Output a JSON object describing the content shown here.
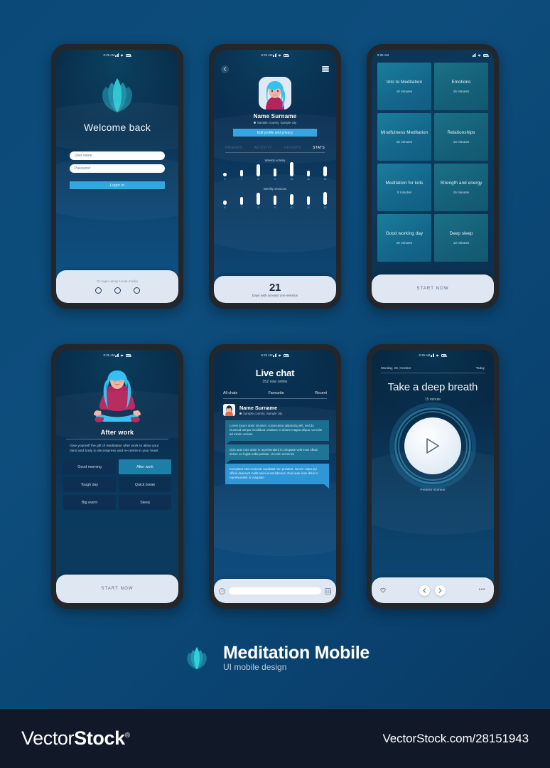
{
  "page": {
    "background_color": "#0b4a78"
  },
  "status_bar": {
    "time": "6:25 AM",
    "icons": [
      "signal-icon",
      "wifi-icon",
      "battery-icon"
    ]
  },
  "screens": {
    "login": {
      "name": "login-screen",
      "logo": "lotus-logo",
      "heading": "Welcome back",
      "username_placeholder": "User name",
      "password_placeholder": "Password",
      "login_button": "Login in",
      "social_label": "Or login using social media",
      "social_count": 3
    },
    "profile": {
      "name": "profile-stats-screen",
      "back_icon": "chevron-left-icon",
      "menu_icon": "hamburger-menu-icon",
      "user_name": "Name Surname",
      "user_location": "Sample country, Sample city",
      "edit_button": "Edit profile and privacy",
      "tabs": [
        {
          "label": "FRIENDS",
          "active": false
        },
        {
          "label": "ACTIVITY",
          "active": false
        },
        {
          "label": "GROUPS",
          "active": false
        },
        {
          "label": "STATS",
          "active": true
        }
      ],
      "chart_data": [
        {
          "type": "bar",
          "title": "Weekly activity",
          "categories": [
            "6",
            "7",
            "8",
            "9",
            "10",
            "11",
            "12"
          ],
          "values": [
            5,
            9,
            17,
            11,
            20,
            8,
            14
          ],
          "ylim": [
            0,
            22
          ],
          "xlabel": "",
          "ylabel": "",
          "grid": false,
          "legend": "none"
        },
        {
          "type": "bar",
          "title": "Weekly sessions",
          "categories": [
            "6",
            "7",
            "8",
            "9",
            "10",
            "11",
            "12"
          ],
          "values": [
            6,
            11,
            17,
            13,
            15,
            12,
            18
          ],
          "ylim": [
            0,
            22
          ],
          "xlabel": "",
          "ylabel": "",
          "grid": false,
          "legend": "none"
        }
      ],
      "streak_number": "21",
      "streak_label": "Days with at least one session"
    },
    "categories": {
      "name": "meditation-categories-screen",
      "items": [
        {
          "title": "Into to Meditation",
          "duration": "10 minutes"
        },
        {
          "title": "Emotions",
          "duration": "15 minutes"
        },
        {
          "title": "Mindfulness Meditation",
          "duration": "20 minutes"
        },
        {
          "title": "Relationships",
          "duration": "10 minutes"
        },
        {
          "title": "Meditation for kids",
          "duration": "5 minutes"
        },
        {
          "title": "Strength and energy",
          "duration": "15 minutes"
        },
        {
          "title": "Good working day",
          "duration": "20 minutes"
        },
        {
          "title": "Deep sleep",
          "duration": "10 minutes"
        }
      ],
      "start_button": "START NOW"
    },
    "after_work": {
      "name": "after-work-screen",
      "illustration": "meditating-woman-illustration",
      "title": "After work",
      "description": "Give yourself the gift of meditation after work to allow your mind and body to decompress and re-centre in your heart",
      "options": [
        {
          "label": "Good morning",
          "selected": false
        },
        {
          "label": "After work",
          "selected": true
        },
        {
          "label": "Tough day",
          "selected": false
        },
        {
          "label": "Quick break",
          "selected": false
        },
        {
          "label": "Big event",
          "selected": false
        },
        {
          "label": "Sleep",
          "selected": false
        }
      ],
      "start_button": "START NOW"
    },
    "live_chat": {
      "name": "live-chat-screen",
      "title": "Live chat",
      "subtitle": "352 now online",
      "tabs": [
        {
          "label": "All chats"
        },
        {
          "label": "Favourite"
        },
        {
          "label": "Recent"
        }
      ],
      "contact_name": "Name Surname",
      "contact_location": "Sample country, Sample city",
      "messages": [
        {
          "side": "incoming",
          "text": "Lorem ipsum dolor sit amet, consectetur adipiscing elit, sed do eiusmod tempor incididunt ut labore et dolore magna aliqua. Ut enim ad minim veniam"
        },
        {
          "side": "incoming",
          "text": "Duis aute irure dolor in reprehenderit in voluptate velit esse cillum dolore eu fugiat nulla pariatur. Ut enim ad minim"
        },
        {
          "side": "outgoing",
          "text": "Excepteur sint occaecat cupidatat non proident, sunt in culpa qui officia deserunt mollit anim id est laborum. Duis aute irure dolor in reprehenderit in voluptate"
        }
      ],
      "input_placeholder": "",
      "emoji_icon": "emoji-smiley-icon",
      "camera_icon": "camera-icon"
    },
    "breathe": {
      "name": "breathe-player-screen",
      "date": "Monday, 28, October",
      "today_label": "Today",
      "title": "Take a deep breath",
      "duration": "15 minute",
      "footer_label": "Present moment",
      "play_icon": "play-icon",
      "nav": {
        "favourite_icon": "heart-icon",
        "prev_icon": "chevron-left-icon",
        "next_icon": "chevron-right-icon",
        "more_icon": "ellipsis-icon"
      }
    }
  },
  "brand": {
    "logo": "lotus-logo",
    "title": "Meditation  Mobile",
    "subtitle": "UI mobile design"
  },
  "watermark": {
    "logo_light": "Vector",
    "logo_bold": "Stock",
    "registered": "®",
    "url": "VectorStock.com/28151943"
  }
}
